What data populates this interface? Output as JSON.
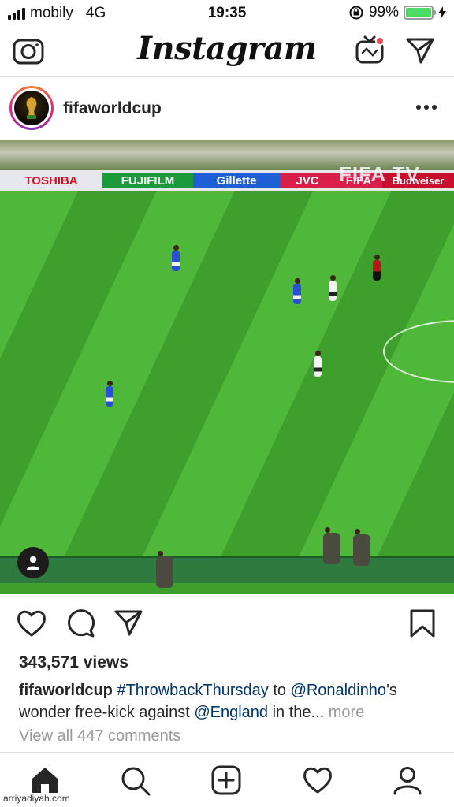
{
  "status_bar": {
    "carrier": "mobily",
    "network": "4G",
    "time": "19:35",
    "battery_percent": "99%",
    "battery_level": 0.99,
    "battery_color": "#4cd964",
    "icons": [
      "signal-bars-icon",
      "rotation-lock-icon",
      "battery-icon",
      "charging-bolt-icon"
    ]
  },
  "top_nav": {
    "brand": "Instagram",
    "icons": [
      "camera-icon",
      "igtv-icon",
      "direct-message-icon"
    ],
    "notification_dot_color": "#ed4956"
  },
  "post": {
    "username": "fifaworldcup",
    "video_watermark": "FIFA TV",
    "ads": [
      "TOSHIBA",
      "FUJIFILM",
      "Gillette",
      "JVC",
      "FIFA",
      "Budweiser"
    ],
    "views": "343,571 views",
    "caption": {
      "user": "fifaworldcup",
      "hashtag": "#ThrowbackThursday",
      "text_to": " to ",
      "mention1": "@Ronaldinho",
      "text_mid": "'s wonder free-kick against ",
      "mention2": "@England",
      "text_end": " in the...",
      "more": "more"
    },
    "comments_link": "View all 447 comments",
    "actions": [
      "heart-icon",
      "comment-icon",
      "share-icon",
      "bookmark-icon"
    ]
  },
  "bottom_nav": {
    "items": [
      "home-icon",
      "search-icon",
      "add-post-icon",
      "activity-heart-icon",
      "profile-icon"
    ]
  },
  "credit": "arriyadiyah.com",
  "colors": {
    "link": "#003569",
    "muted": "#999999",
    "text": "#262626",
    "pitch_green": "#4fb83a"
  }
}
